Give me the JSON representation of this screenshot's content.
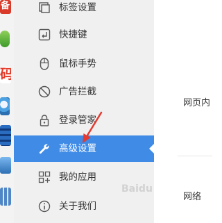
{
  "desktop_strip": {
    "icon1_text": "备",
    "icon3_text": "码"
  },
  "sidebar": {
    "items": [
      {
        "label": "标签设置",
        "icon": "tab-settings-icon"
      },
      {
        "label": "快捷键",
        "icon": "keyboard-shortcut-icon"
      },
      {
        "label": "鼠标手势",
        "icon": "mouse-icon"
      },
      {
        "label": "广告拦截",
        "icon": "block-icon"
      },
      {
        "label": "登录管家",
        "icon": "lock-icon"
      },
      {
        "label": "高级设置",
        "icon": "wrench-icon",
        "active": true
      },
      {
        "label": "我的应用",
        "icon": "apps-grid-icon"
      },
      {
        "label": "关于我们",
        "icon": "info-icon"
      }
    ]
  },
  "content": {
    "section1_title": "网页内",
    "section2_title": "网络"
  },
  "colors": {
    "active_bg": "#3f8be6",
    "sidebar_bg": "#f0f0f0",
    "annotation": "#e53a2f"
  },
  "watermark": "Baidu"
}
